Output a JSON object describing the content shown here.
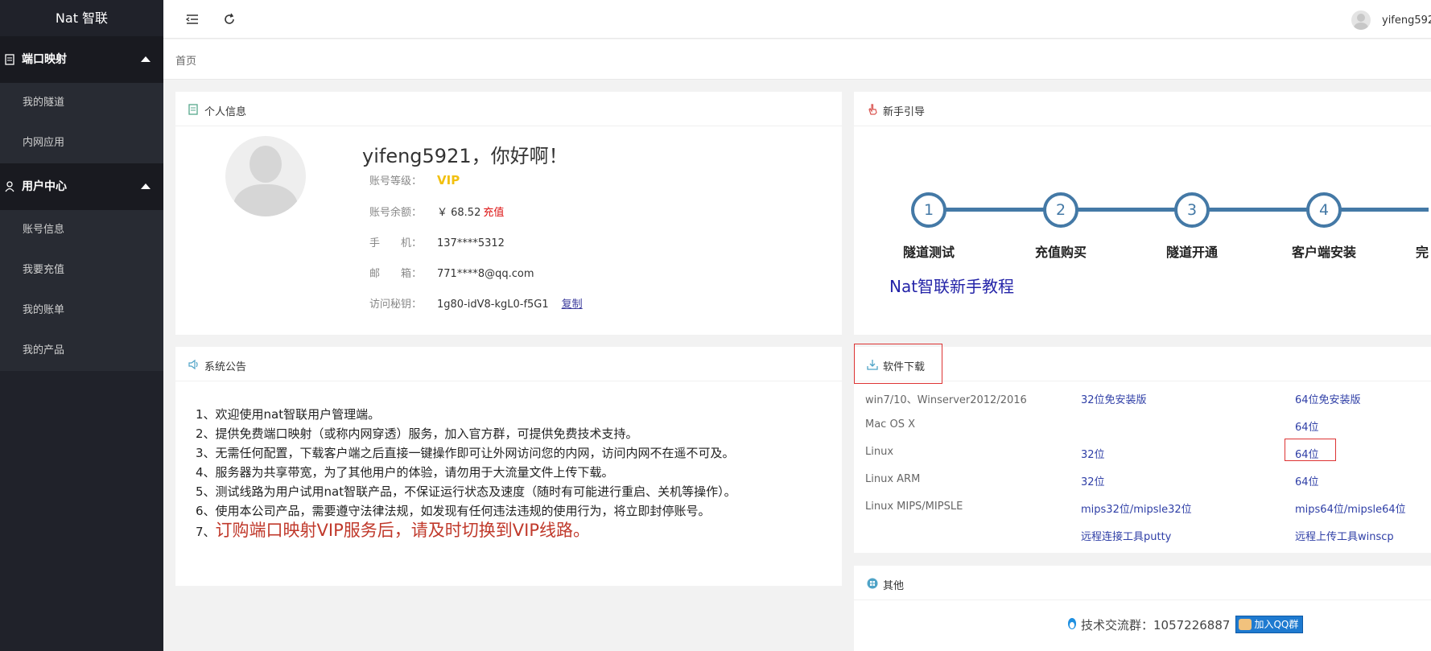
{
  "sidebar": {
    "logo": "Nat 智联",
    "groups": [
      {
        "label": "端口映射",
        "items": [
          "我的隧道",
          "内网应用"
        ]
      },
      {
        "label": "用户中心",
        "items": [
          "账号信息",
          "我要充值",
          "我的账单",
          "我的产品"
        ]
      }
    ]
  },
  "header": {
    "username": "yifeng592"
  },
  "breadcrumb": {
    "home": "首页"
  },
  "profile": {
    "title": "个人信息",
    "greeting": "yifeng5921，你好啊！",
    "level_label": "账号等级：",
    "level_value": "VIP",
    "balance_label": "账号余额：",
    "balance_value": "￥ 68.52",
    "recharge_link": "充值",
    "phone_label": "手　　机：",
    "phone_value": "137****5312",
    "email_label": "邮　　箱：",
    "email_value": "771****8@qq.com",
    "key_label": "访问秘钥：",
    "key_value": "1g80-idV8-kgL0-f5G1",
    "copy_link": "复制"
  },
  "guide": {
    "title": "新手引导",
    "steps": [
      {
        "num": "1",
        "label": "隧道测试"
      },
      {
        "num": "2",
        "label": "充值购买"
      },
      {
        "num": "3",
        "label": "隧道开通"
      },
      {
        "num": "4",
        "label": "客户端安装"
      },
      {
        "num": "5",
        "label": "完"
      }
    ],
    "tutorial": "Nat智联新手教程"
  },
  "announcement": {
    "title": "系统公告",
    "items": [
      "1、欢迎使用nat智联用户管理端。",
      "2、提供免费端口映射（或称内网穿透）服务，加入官方群，可提供免费技术支持。",
      "3、无需任何配置，下载客户端之后直接一键操作即可让外网访问您的内网，访问内网不在遥不可及。",
      "4、服务器为共享带宽，为了其他用户的体验，请勿用于大流量文件上传下载。",
      "5、测试线路为用户试用nat智联产品，不保证运行状态及速度（随时有可能进行重启、关机等操作）。",
      "6、使用本公司产品，需要遵守法律法规，如发现有任何违法违规的使用行为，将立即封停账号。"
    ],
    "highlight_prefix": "7、",
    "highlight": "订购端口映射VIP服务后，请及时切换到VIP线路。"
  },
  "downloads": {
    "title": "软件下载",
    "rows": [
      {
        "os": "win7/10、Winserver2012/2016",
        "a": "32位免安装版",
        "b": "64位免安装版"
      },
      {
        "os": "Mac OS X",
        "a": "",
        "b": "64位"
      },
      {
        "os": "Linux",
        "a": "32位",
        "b": "64位"
      },
      {
        "os": "Linux ARM",
        "a": "32位",
        "b": "64位"
      },
      {
        "os": "Linux MIPS/MIPSLE",
        "a": "mips32位/mipsle32位",
        "b": "mips64位/mipsle64位"
      },
      {
        "os": "",
        "a": "远程连接工具putty",
        "b": "远程上传工具winscp"
      }
    ]
  },
  "others": {
    "title": "其他",
    "qq_group_text": "技术交流群：1057226887",
    "qq_button": "加入QQ群"
  },
  "colors": {
    "sidebar_bg": "#20222a",
    "accent": "#4479a6",
    "vip": "#f2c010",
    "link": "#2e3ea6",
    "alert": "#c0392b"
  }
}
